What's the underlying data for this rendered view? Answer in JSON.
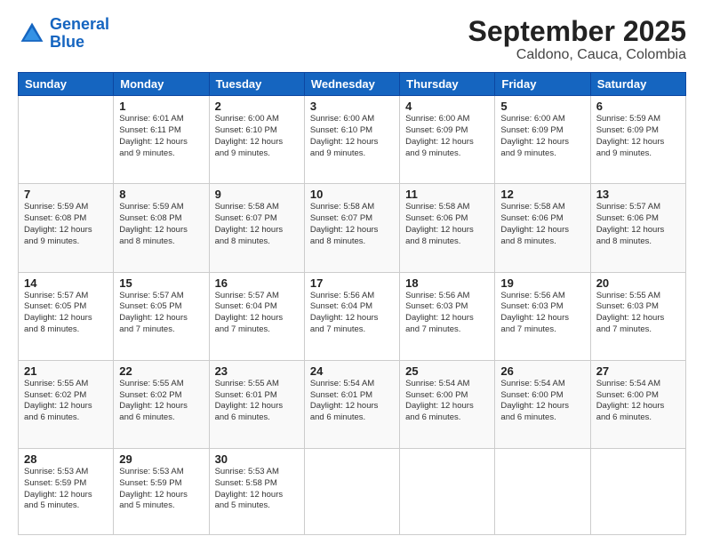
{
  "header": {
    "logo_line1": "General",
    "logo_line2": "Blue",
    "month": "September 2025",
    "location": "Caldono, Cauca, Colombia"
  },
  "days_of_week": [
    "Sunday",
    "Monday",
    "Tuesday",
    "Wednesday",
    "Thursday",
    "Friday",
    "Saturday"
  ],
  "weeks": [
    [
      {
        "day": "",
        "info": ""
      },
      {
        "day": "1",
        "info": "Sunrise: 6:01 AM\nSunset: 6:11 PM\nDaylight: 12 hours\nand 9 minutes."
      },
      {
        "day": "2",
        "info": "Sunrise: 6:00 AM\nSunset: 6:10 PM\nDaylight: 12 hours\nand 9 minutes."
      },
      {
        "day": "3",
        "info": "Sunrise: 6:00 AM\nSunset: 6:10 PM\nDaylight: 12 hours\nand 9 minutes."
      },
      {
        "day": "4",
        "info": "Sunrise: 6:00 AM\nSunset: 6:09 PM\nDaylight: 12 hours\nand 9 minutes."
      },
      {
        "day": "5",
        "info": "Sunrise: 6:00 AM\nSunset: 6:09 PM\nDaylight: 12 hours\nand 9 minutes."
      },
      {
        "day": "6",
        "info": "Sunrise: 5:59 AM\nSunset: 6:09 PM\nDaylight: 12 hours\nand 9 minutes."
      }
    ],
    [
      {
        "day": "7",
        "info": "Sunrise: 5:59 AM\nSunset: 6:08 PM\nDaylight: 12 hours\nand 9 minutes."
      },
      {
        "day": "8",
        "info": "Sunrise: 5:59 AM\nSunset: 6:08 PM\nDaylight: 12 hours\nand 8 minutes."
      },
      {
        "day": "9",
        "info": "Sunrise: 5:58 AM\nSunset: 6:07 PM\nDaylight: 12 hours\nand 8 minutes."
      },
      {
        "day": "10",
        "info": "Sunrise: 5:58 AM\nSunset: 6:07 PM\nDaylight: 12 hours\nand 8 minutes."
      },
      {
        "day": "11",
        "info": "Sunrise: 5:58 AM\nSunset: 6:06 PM\nDaylight: 12 hours\nand 8 minutes."
      },
      {
        "day": "12",
        "info": "Sunrise: 5:58 AM\nSunset: 6:06 PM\nDaylight: 12 hours\nand 8 minutes."
      },
      {
        "day": "13",
        "info": "Sunrise: 5:57 AM\nSunset: 6:06 PM\nDaylight: 12 hours\nand 8 minutes."
      }
    ],
    [
      {
        "day": "14",
        "info": "Sunrise: 5:57 AM\nSunset: 6:05 PM\nDaylight: 12 hours\nand 8 minutes."
      },
      {
        "day": "15",
        "info": "Sunrise: 5:57 AM\nSunset: 6:05 PM\nDaylight: 12 hours\nand 7 minutes."
      },
      {
        "day": "16",
        "info": "Sunrise: 5:57 AM\nSunset: 6:04 PM\nDaylight: 12 hours\nand 7 minutes."
      },
      {
        "day": "17",
        "info": "Sunrise: 5:56 AM\nSunset: 6:04 PM\nDaylight: 12 hours\nand 7 minutes."
      },
      {
        "day": "18",
        "info": "Sunrise: 5:56 AM\nSunset: 6:03 PM\nDaylight: 12 hours\nand 7 minutes."
      },
      {
        "day": "19",
        "info": "Sunrise: 5:56 AM\nSunset: 6:03 PM\nDaylight: 12 hours\nand 7 minutes."
      },
      {
        "day": "20",
        "info": "Sunrise: 5:55 AM\nSunset: 6:03 PM\nDaylight: 12 hours\nand 7 minutes."
      }
    ],
    [
      {
        "day": "21",
        "info": "Sunrise: 5:55 AM\nSunset: 6:02 PM\nDaylight: 12 hours\nand 6 minutes."
      },
      {
        "day": "22",
        "info": "Sunrise: 5:55 AM\nSunset: 6:02 PM\nDaylight: 12 hours\nand 6 minutes."
      },
      {
        "day": "23",
        "info": "Sunrise: 5:55 AM\nSunset: 6:01 PM\nDaylight: 12 hours\nand 6 minutes."
      },
      {
        "day": "24",
        "info": "Sunrise: 5:54 AM\nSunset: 6:01 PM\nDaylight: 12 hours\nand 6 minutes."
      },
      {
        "day": "25",
        "info": "Sunrise: 5:54 AM\nSunset: 6:00 PM\nDaylight: 12 hours\nand 6 minutes."
      },
      {
        "day": "26",
        "info": "Sunrise: 5:54 AM\nSunset: 6:00 PM\nDaylight: 12 hours\nand 6 minutes."
      },
      {
        "day": "27",
        "info": "Sunrise: 5:54 AM\nSunset: 6:00 PM\nDaylight: 12 hours\nand 6 minutes."
      }
    ],
    [
      {
        "day": "28",
        "info": "Sunrise: 5:53 AM\nSunset: 5:59 PM\nDaylight: 12 hours\nand 5 minutes."
      },
      {
        "day": "29",
        "info": "Sunrise: 5:53 AM\nSunset: 5:59 PM\nDaylight: 12 hours\nand 5 minutes."
      },
      {
        "day": "30",
        "info": "Sunrise: 5:53 AM\nSunset: 5:58 PM\nDaylight: 12 hours\nand 5 minutes."
      },
      {
        "day": "",
        "info": ""
      },
      {
        "day": "",
        "info": ""
      },
      {
        "day": "",
        "info": ""
      },
      {
        "day": "",
        "info": ""
      }
    ]
  ]
}
